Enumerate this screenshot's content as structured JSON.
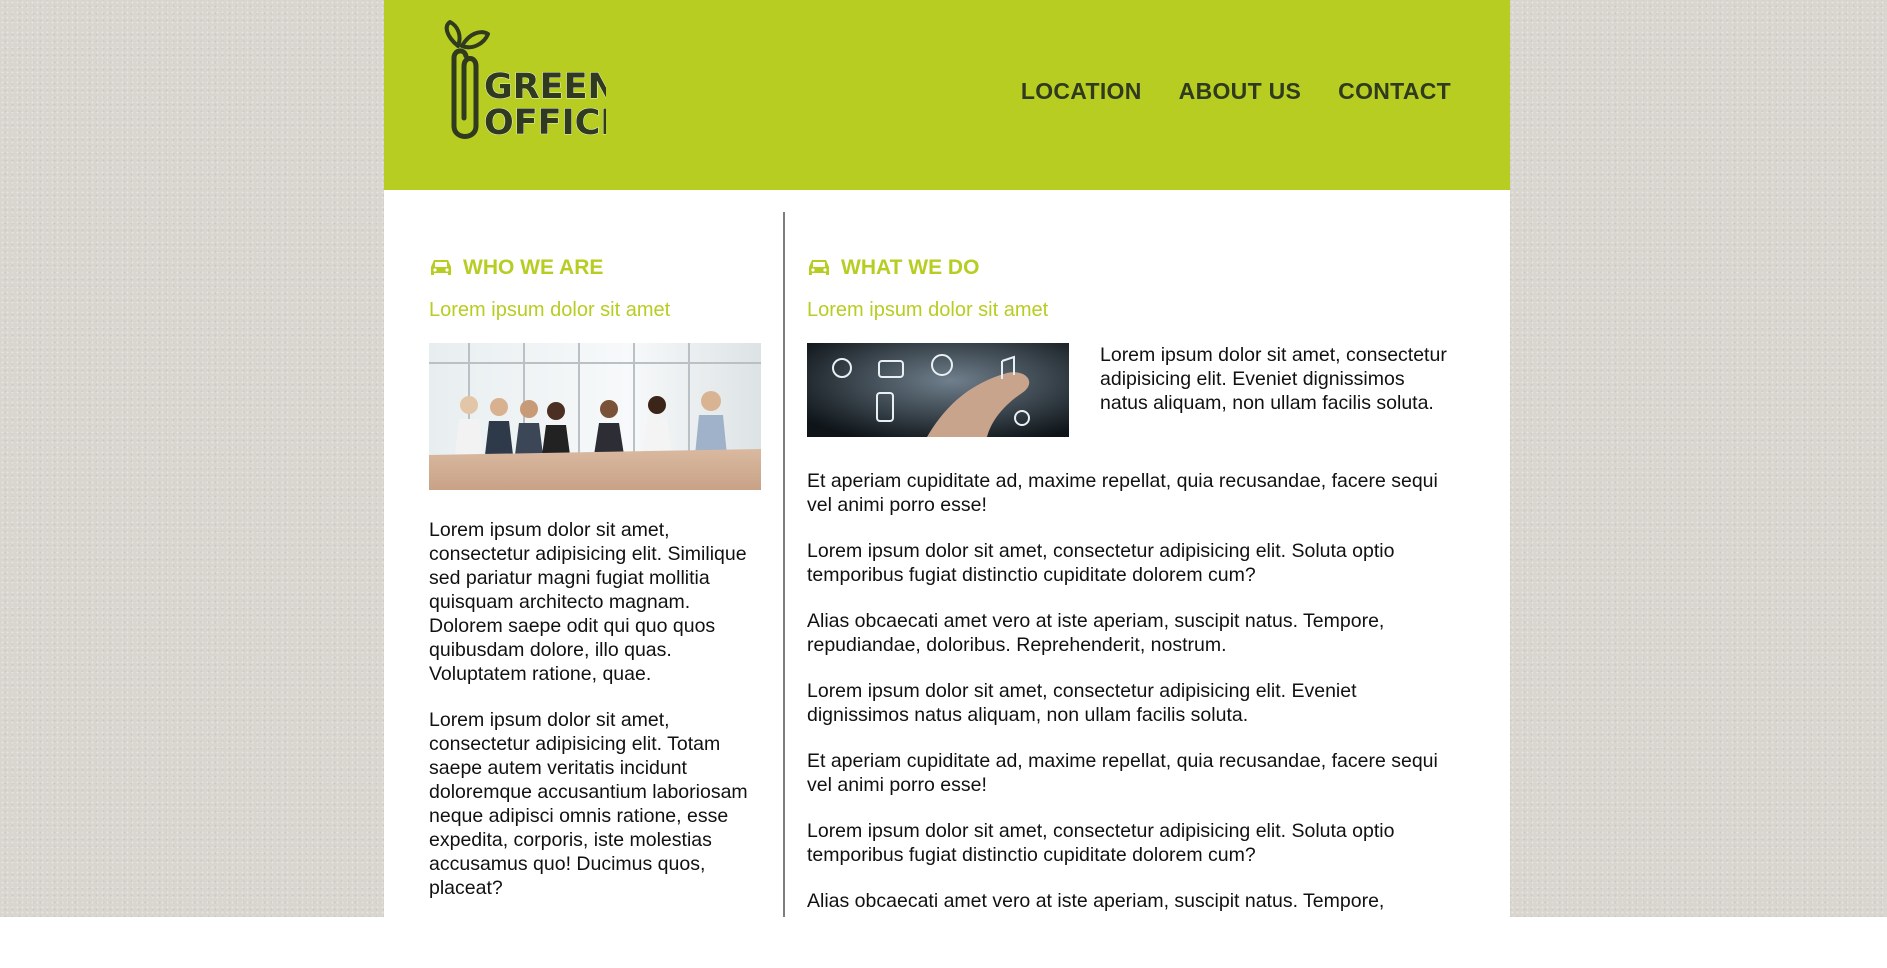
{
  "header": {
    "logo": {
      "line1": "GREEN",
      "line2": "OFFICE",
      "icon": "paperclip-sprout-logo"
    },
    "nav": [
      {
        "label": "LOCATION"
      },
      {
        "label": "ABOUT US"
      },
      {
        "label": "CONTACT"
      }
    ]
  },
  "left": {
    "heading": "WHO WE ARE",
    "heading_icon": "car-icon",
    "subtitle": "Lorem ipsum dolor sit amet",
    "image": "team-meeting-photo",
    "paragraphs": [
      "Lorem ipsum dolor sit amet, consectetur adipisicing elit. Similique sed pariatur magni fugiat mollitia quisquam architecto magnam. Dolorem saepe odit qui quo quos quibusdam dolore, illo quas. Voluptatem ratione, quae.",
      "Lorem ipsum dolor sit amet, consectetur adipisicing elit. Totam saepe autem veritatis incidunt doloremque accusantium laboriosam neque adipisci omnis ratione, esse expedita, corporis, iste molestias accusamus quo! Ducimus quos, placeat?"
    ]
  },
  "right": {
    "heading": "WHAT WE DO",
    "heading_icon": "car-icon",
    "subtitle": "Lorem ipsum dolor sit amet",
    "image": "technology-touch-photo",
    "float_paragraph": "Lorem ipsum dolor sit amet, consectetur adipisicing elit. Eveniet dignissimos natus aliquam, non ullam facilis soluta.",
    "paragraphs": [
      "Et aperiam cupiditate ad, maxime repellat, quia recusandae, facere sequi vel animi porro esse!",
      "Lorem ipsum dolor sit amet, consectetur adipisicing elit. Soluta optio temporibus fugiat distinctio cupiditate dolorem cum?",
      "Alias obcaecati amet vero at iste aperiam, suscipit natus. Tempore, repudiandae, doloribus. Reprehenderit, nostrum.",
      "Lorem ipsum dolor sit amet, consectetur adipisicing elit. Eveniet dignissimos natus aliquam, non ullam facilis soluta.",
      "Et aperiam cupiditate ad, maxime repellat, quia recusandae, facere sequi vel animi porro esse!",
      "Lorem ipsum dolor sit amet, consectetur adipisicing elit. Soluta optio temporibus fugiat distinctio cupiditate dolorem cum?",
      "Alias obcaecati amet vero at iste aperiam, suscipit natus. Tempore, repudiandae, doloribus. Reprehenderit, nostrum."
    ]
  },
  "colors": {
    "accent": "#b8cd22",
    "nav_text": "#2f3a1e",
    "logo_dark": "#2f3a1e",
    "body_text": "#111111",
    "divider": "#7d7d7d",
    "background": "#d9d5cf"
  }
}
